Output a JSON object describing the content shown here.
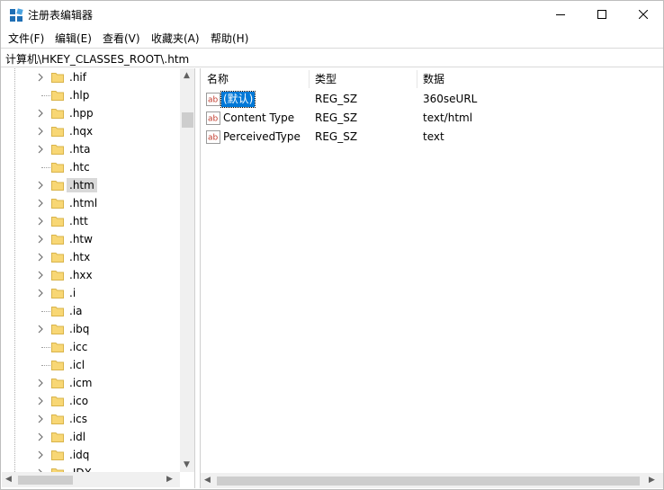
{
  "titlebar": {
    "title": "注册表编辑器"
  },
  "menu": [
    "文件(F)",
    "编辑(E)",
    "查看(V)",
    "收藏夹(A)",
    "帮助(H)"
  ],
  "address": {
    "path": "计算机\\HKEY_CLASSES_ROOT\\.htm"
  },
  "tree": {
    "items": [
      {
        "label": ".hif",
        "expandable": true
      },
      {
        "label": ".hlp",
        "expandable": false
      },
      {
        "label": ".hpp",
        "expandable": true
      },
      {
        "label": ".hqx",
        "expandable": true
      },
      {
        "label": ".hta",
        "expandable": true
      },
      {
        "label": ".htc",
        "expandable": false
      },
      {
        "label": ".htm",
        "expandable": true,
        "selected": true
      },
      {
        "label": ".html",
        "expandable": true
      },
      {
        "label": ".htt",
        "expandable": true
      },
      {
        "label": ".htw",
        "expandable": true
      },
      {
        "label": ".htx",
        "expandable": true
      },
      {
        "label": ".hxx",
        "expandable": true
      },
      {
        "label": ".i",
        "expandable": true
      },
      {
        "label": ".ia",
        "expandable": false
      },
      {
        "label": ".ibq",
        "expandable": true
      },
      {
        "label": ".icc",
        "expandable": false
      },
      {
        "label": ".icl",
        "expandable": false
      },
      {
        "label": ".icm",
        "expandable": true
      },
      {
        "label": ".ico",
        "expandable": true
      },
      {
        "label": ".ics",
        "expandable": true
      },
      {
        "label": ".idl",
        "expandable": true
      },
      {
        "label": ".idq",
        "expandable": true
      },
      {
        "label": ".IDX",
        "expandable": true
      }
    ]
  },
  "columns": {
    "name": "名称",
    "type": "类型",
    "data": "数据"
  },
  "values": [
    {
      "name": "(默认)",
      "type": "REG_SZ",
      "data": "360seURL",
      "selected": true
    },
    {
      "name": "Content Type",
      "type": "REG_SZ",
      "data": "text/html"
    },
    {
      "name": "PerceivedType",
      "type": "REG_SZ",
      "data": "text"
    }
  ],
  "icons": {
    "app": "registry-editor-icon",
    "minimize": "minimize-icon",
    "maximize": "maximize-icon",
    "close": "close-icon",
    "folder": "folder-icon",
    "value": "reg-string-value-icon"
  },
  "colors": {
    "selection": "#0078d7",
    "folder": "#f8d775",
    "tree_selection": "#d9d9d9"
  }
}
